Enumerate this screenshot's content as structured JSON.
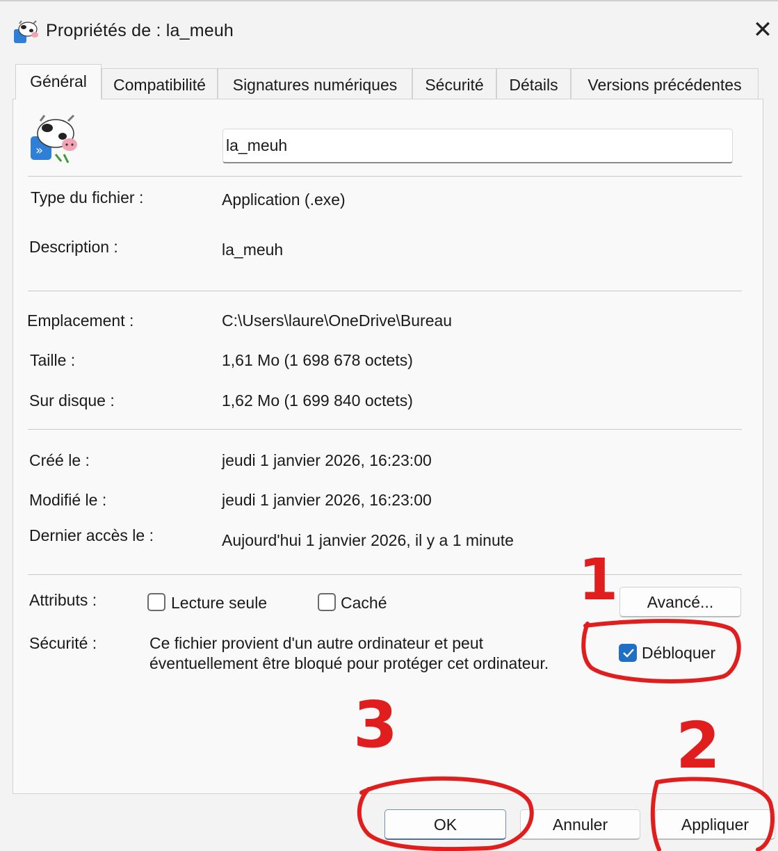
{
  "window": {
    "title": "Propriétés de : la_meuh",
    "close_icon": "close-icon"
  },
  "tabs": [
    {
      "label": "Général",
      "active": true
    },
    {
      "label": "Compatibilité"
    },
    {
      "label": "Signatures numériques"
    },
    {
      "label": "Sécurité"
    },
    {
      "label": "Détails"
    },
    {
      "label": "Versions précédentes"
    }
  ],
  "general": {
    "file_name": "la_meuh",
    "file_type_label": "Type du fichier :",
    "file_type_value": "Application (.exe)",
    "description_label": "Description :",
    "description_value": "la_meuh",
    "location_label": "Emplacement :",
    "location_value": "C:\\Users\\laure\\OneDrive\\Bureau",
    "size_label": "Taille :",
    "size_value": "1,61 Mo (1 698 678 octets)",
    "disk_label": "Sur disque :",
    "disk_value": "1,62 Mo (1 699 840 octets)",
    "created_label": "Créé le :",
    "created_value": "jeudi 1 janvier 2026, 16:23:00",
    "modified_label": "Modifié le :",
    "modified_value": "jeudi 1 janvier 2026, 16:23:00",
    "accessed_label": "Dernier accès le :",
    "accessed_value": "Aujourd'hui 1 janvier 2026, il y a 1 minute",
    "attributes_label": "Attributs :",
    "readonly_label": "Lecture seule",
    "readonly_checked": false,
    "hidden_label": "Caché",
    "hidden_checked": false,
    "advanced_button": "Avancé...",
    "security_label": "Sécurité :",
    "security_text_line1": "Ce fichier provient d'un autre ordinateur et peut",
    "security_text_line2": "éventuellement être bloqué pour protéger cet ordinateur.",
    "unblock_label": "Débloquer",
    "unblock_checked": true
  },
  "footer": {
    "ok": "OK",
    "cancel": "Annuler",
    "apply": "Appliquer"
  },
  "annotations": {
    "color": "#e01e1e",
    "step1": "1",
    "step2": "2",
    "step3": "3"
  },
  "colors": {
    "accent": "#1f6fc5"
  }
}
